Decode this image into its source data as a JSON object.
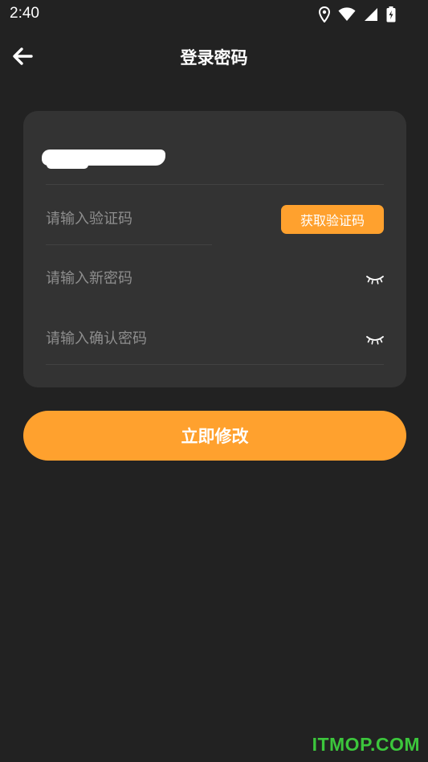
{
  "status_bar": {
    "time": "2:40",
    "icons": [
      "location-icon",
      "wifi-icon",
      "signal-icon",
      "battery-charging-icon"
    ]
  },
  "header": {
    "title": "登录密码",
    "back_icon": "arrow-left-icon"
  },
  "form": {
    "account_masked": true,
    "code_placeholder": "请输入验证码",
    "get_code_label": "获取验证码",
    "new_password_placeholder": "请输入新密码",
    "confirm_password_placeholder": "请输入确认密码",
    "eye_icon": "eye-closed-icon"
  },
  "submit": {
    "label": "立即修改"
  },
  "watermark": {
    "text": "ITMOP.COM"
  },
  "colors": {
    "background": "#222222",
    "card": "#333333",
    "accent": "#ffa12e",
    "placeholder": "#8e8e8e",
    "watermark": "#3cc63c"
  }
}
